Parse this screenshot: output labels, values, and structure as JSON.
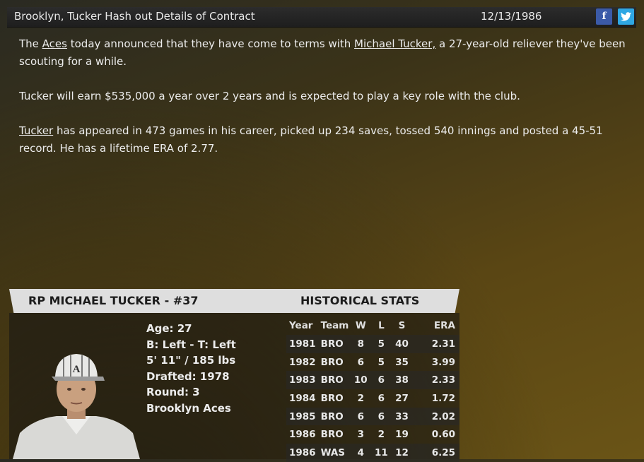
{
  "header": {
    "headline": "Brooklyn, Tucker Hash out Details of Contract",
    "date": "12/13/1986",
    "share": {
      "facebook_icon": "facebook-icon",
      "twitter_icon": "twitter-icon"
    }
  },
  "article": {
    "p1_pre": "The ",
    "p1_team": "Aces",
    "p1_mid": " today announced that they have come to terms with ",
    "p1_player": "Michael Tucker,",
    "p1_post": " a 27-year-old reliever they've been scouting for a while.",
    "p2": "Tucker will earn $535,000 a year over 2 years and is expected to play a key role with the club.",
    "p3_player": "Tucker",
    "p3_post": " has appeared in 473 games in his career, picked up 234 saves, tossed 540 innings and posted a 45-51 record. He has a lifetime ERA of 2.77."
  },
  "player_card": {
    "title": "RP MICHAEL TUCKER - #37",
    "bio": {
      "age": "Age: 27",
      "bats_throws": "B: Left - T: Left",
      "height_weight": "5' 11\" / 185 lbs",
      "drafted": "Drafted: 1978",
      "round": "Round: 3",
      "team": "Brooklyn Aces"
    }
  },
  "stats": {
    "title": "HISTORICAL STATS",
    "columns": [
      "Year",
      "Team",
      "W",
      "L",
      "S",
      "ERA"
    ],
    "rows": [
      [
        "1981",
        "BRO",
        "8",
        "5",
        "40",
        "2.31"
      ],
      [
        "1982",
        "BRO",
        "6",
        "5",
        "35",
        "3.99"
      ],
      [
        "1983",
        "BRO",
        "10",
        "6",
        "38",
        "2.33"
      ],
      [
        "1984",
        "BRO",
        "2",
        "6",
        "27",
        "1.72"
      ],
      [
        "1985",
        "BRO",
        "6",
        "6",
        "33",
        "2.02"
      ],
      [
        "1986",
        "BRO",
        "3",
        "2",
        "19",
        "0.60"
      ],
      [
        "1986",
        "WAS",
        "4",
        "11",
        "12",
        "6.25"
      ]
    ]
  }
}
